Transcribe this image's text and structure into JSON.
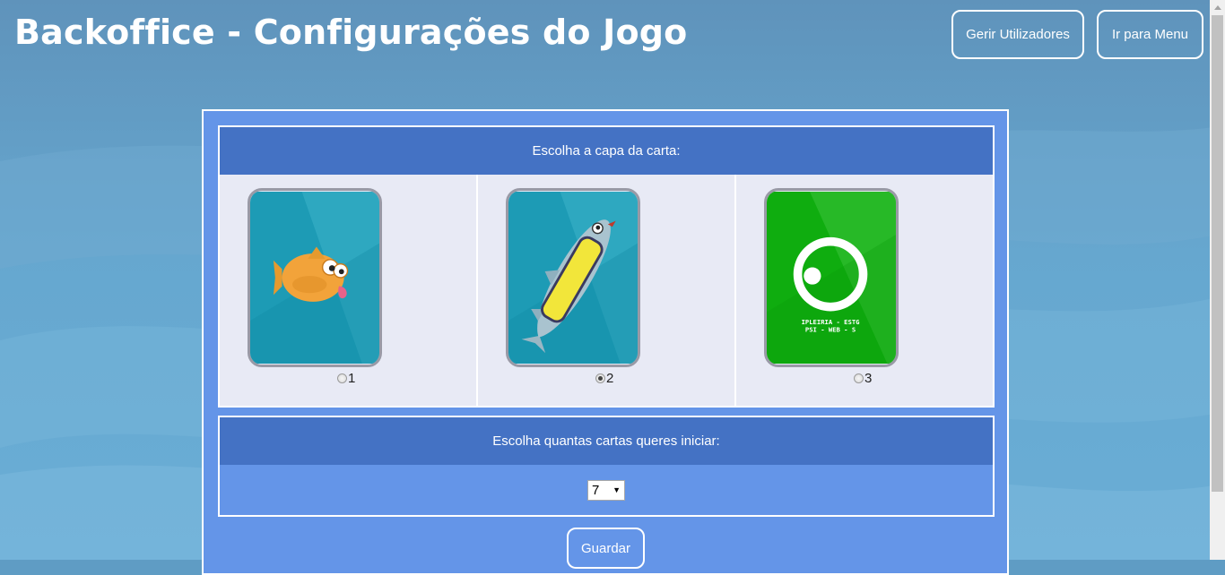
{
  "header": {
    "title": "Backoffice - Configurações do Jogo",
    "buttons": {
      "users": "Gerir Utilizadores",
      "menu": "Ir para Menu"
    }
  },
  "cover_section": {
    "heading": "Escolha a capa da carta:",
    "options": [
      {
        "value": "1",
        "icon": "orange-fish-card-icon",
        "checked": false
      },
      {
        "value": "2",
        "icon": "go-fish-card-icon",
        "checked": true
      },
      {
        "value": "3",
        "icon": "ipleiria-logo-card-icon",
        "checked": false,
        "card_text": [
          "IPLEIRIA - ESTG",
          "PSI - WEB - S"
        ]
      }
    ]
  },
  "cards_section": {
    "heading": "Escolha quantas cartas queres iniciar:",
    "selected_value": "7"
  },
  "save_button": "Guardar",
  "colors": {
    "panel": "#6495e8",
    "header_bar": "#4472c4",
    "cell_bg": "#e8eaf5",
    "card_blue": "#1e9ab5",
    "card_green": "#1db31d"
  }
}
